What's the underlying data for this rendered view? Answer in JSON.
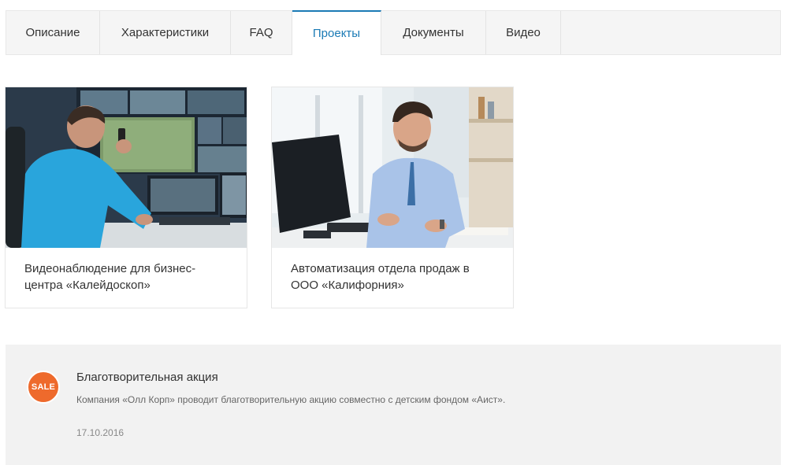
{
  "tabs": [
    {
      "label": "Описание",
      "active": false
    },
    {
      "label": "Характеристики",
      "active": false
    },
    {
      "label": "FAQ",
      "active": false
    },
    {
      "label": "Проекты",
      "active": true
    },
    {
      "label": "Документы",
      "active": false
    },
    {
      "label": "Видео",
      "active": false
    }
  ],
  "projects": [
    {
      "title": "Видеонаблюдение для бизнес-центра «Калейдоскоп»",
      "image": "security-operator-photo"
    },
    {
      "title": "Автоматизация отдела продаж в ООО «Калифорния»",
      "image": "office-worker-photo"
    }
  ],
  "news": {
    "badge": "SALE",
    "title": "Благотворительная акция",
    "description": "Компания «Олл Корп» проводит благотворительную акцию совместно с детским фондом «Аист».",
    "date": "17.10.2016"
  },
  "colors": {
    "accent": "#1a7ab5",
    "sale": "#ee6a2c",
    "tab_bg": "#f5f5f5",
    "news_bg": "#f2f2f2"
  }
}
